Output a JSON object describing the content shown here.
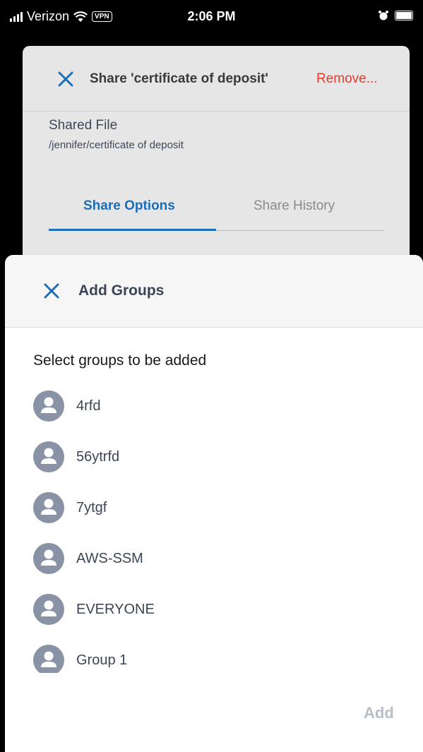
{
  "status_bar": {
    "carrier": "Verizon",
    "vpn": "VPN",
    "time": "2:06 PM"
  },
  "share_dialog": {
    "title": "Share 'certificate of deposit'",
    "remove_label": "Remove...",
    "shared_file_label": "Shared File",
    "shared_file_path": "/jennifer/certificate of deposit",
    "tabs": [
      {
        "label": "Share Options",
        "active": true
      },
      {
        "label": "Share History",
        "active": false
      }
    ]
  },
  "add_groups": {
    "title": "Add Groups",
    "prompt": "Select groups to be added",
    "groups": [
      "4rfd",
      "56ytrfd",
      "7ytgf",
      "AWS-SSM",
      "EVERYONE",
      "Group 1"
    ],
    "add_label": "Add"
  },
  "colors": {
    "accent": "#1b6eb8",
    "remove": "#e53b2f",
    "avatar": "#8a93a5",
    "disabled": "#b8bec6"
  }
}
